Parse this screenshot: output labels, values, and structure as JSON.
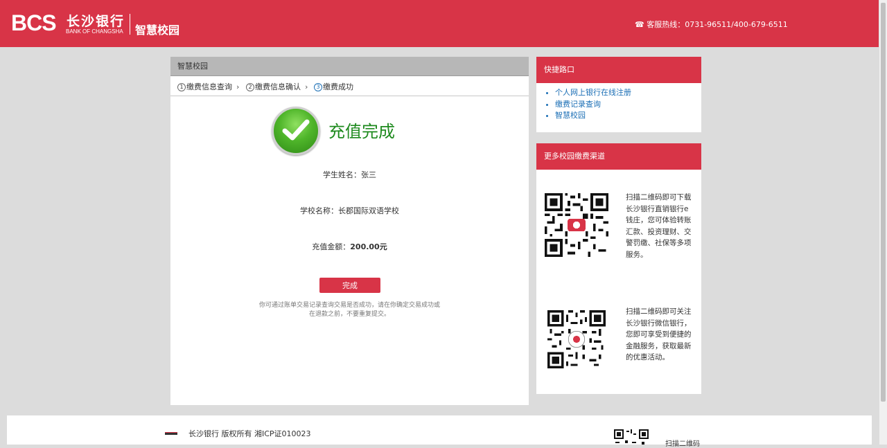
{
  "header": {
    "logo_mark": "BCS",
    "logo_cn": "长沙银行",
    "logo_en": "BANK OF CHANGSHA",
    "logo_sub": "智慧校园",
    "hotline_icon": "phone-icon",
    "hotline": "☎ 客服热线：0731-96511/400-679-6511"
  },
  "panel": {
    "title": "智慧校园",
    "steps": [
      {
        "num": "1",
        "label": "缴费信息查询"
      },
      {
        "num": "2",
        "label": "缴费信息确认"
      },
      {
        "num": "3",
        "label": "缴费成功"
      }
    ],
    "success_text": "充值完成",
    "student_line": "学生姓名：张三",
    "school_line": "学校名称：长郡国际双语学校",
    "amount_label": "充值金额：",
    "amount_value": "200.00元",
    "done_button": "完成",
    "note_line1": "你可通过账单交易记录查询交易是否成功，请在你确定交易成功或",
    "note_line2": "在退款之前，不要重复提交。"
  },
  "quick_links": {
    "title": "快捷路口",
    "items": [
      "个人网上银行在线注册",
      "缴费记录查询",
      "智慧校园"
    ]
  },
  "channels": {
    "title": "更多校园缴费渠道",
    "qr1_lines": [
      "扫描二维码即可下载",
      "长沙银行直销银行e",
      "钱庄，您可体验转账",
      "汇款、投资理财、交",
      "警罚缴、社保等多项",
      "服务。"
    ],
    "qr2_lines": [
      "扫描二维码即可关注",
      "长沙银行微信银行，",
      "您即可享受到便捷的",
      "金融服务，获取最新",
      "的优惠活动。"
    ]
  },
  "footer": {
    "copyright": "长沙银行 版权所有 湘ICP证010023",
    "qr_label": "扫描二维码"
  },
  "colors": {
    "brand_red": "#d83447",
    "link_blue": "#1a6eb5",
    "success_green": "#1e8a1e"
  }
}
